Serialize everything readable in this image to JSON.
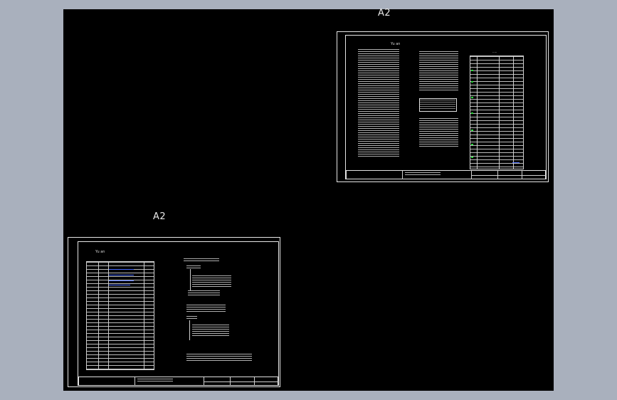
{
  "sheets": [
    {
      "size_label": "A2",
      "title": "Yu   an",
      "blocks": [
        "notes",
        "diagram",
        "table",
        "title-block"
      ]
    },
    {
      "size_label": "A2",
      "title": "Yu   an",
      "blocks": [
        "table",
        "diagram",
        "title-block"
      ]
    }
  ],
  "colors": {
    "workspace_bg": "#a9b0bd",
    "model_space": "#000000",
    "line": "#e6e6e6",
    "accent_green": "#29d83a",
    "accent_blue": "#4a6cff"
  }
}
